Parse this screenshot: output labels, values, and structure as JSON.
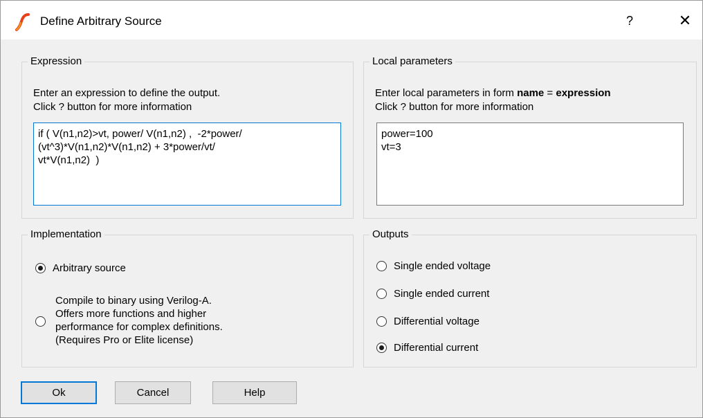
{
  "window": {
    "title": "Define Arbitrary Source",
    "help_glyph": "?",
    "close_glyph": "✕",
    "accent": "#0078d7"
  },
  "expression": {
    "label": "Expression",
    "description_line1": "Enter an expression to define the output.",
    "description_line2": "Click ? button for more information",
    "value": "if ( V(n1,n2)>vt, power/ V(n1,n2) ,  -2*power/\n(vt^3)*V(n1,n2)*V(n1,n2) + 3*power/vt/\nvt*V(n1,n2)  )"
  },
  "local_parameters": {
    "label": "Local parameters",
    "description_prefix": "Enter local parameters in form ",
    "description_name": "name",
    "description_eq": " = ",
    "description_expression": "expression",
    "description_line2": "Click ? button for more information",
    "value": "power=100\nvt=3"
  },
  "implementation": {
    "label": "Implementation",
    "options": [
      {
        "label": "Arbitrary source",
        "checked": true
      },
      {
        "label_lines": [
          "Compile to binary using Verilog-A.",
          "Offers more functions and higher",
          "performance for complex definitions.",
          "(Requires Pro or Elite license)"
        ],
        "checked": false
      }
    ]
  },
  "outputs": {
    "label": "Outputs",
    "options": [
      {
        "label": "Single ended voltage",
        "checked": false
      },
      {
        "label": "Single ended current",
        "checked": false
      },
      {
        "label": "Differential voltage",
        "checked": false
      },
      {
        "label": "Differential current",
        "checked": true
      }
    ]
  },
  "buttons": {
    "ok": "Ok",
    "cancel": "Cancel",
    "help": "Help"
  }
}
